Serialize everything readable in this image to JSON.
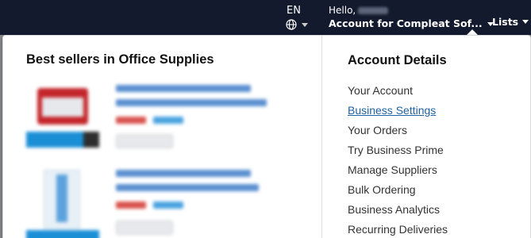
{
  "nav": {
    "language_code": "EN",
    "greeting": "Hello,",
    "account_label": "Account for Compleat Sof...",
    "lists_label": "Lists"
  },
  "best_sellers": {
    "title": "Best sellers in Office Supplies"
  },
  "account_details": {
    "title": "Account Details",
    "items": [
      {
        "label": "Your Account"
      },
      {
        "label": "Business Settings"
      },
      {
        "label": "Your Orders"
      },
      {
        "label": "Try Business Prime"
      },
      {
        "label": "Manage Suppliers"
      },
      {
        "label": "Bulk Ordering"
      },
      {
        "label": "Business Analytics"
      },
      {
        "label": "Recurring Deliveries"
      }
    ]
  },
  "colors": {
    "nav_background": "#131a2e",
    "link_active": "#2162a1",
    "text": "#333333"
  }
}
